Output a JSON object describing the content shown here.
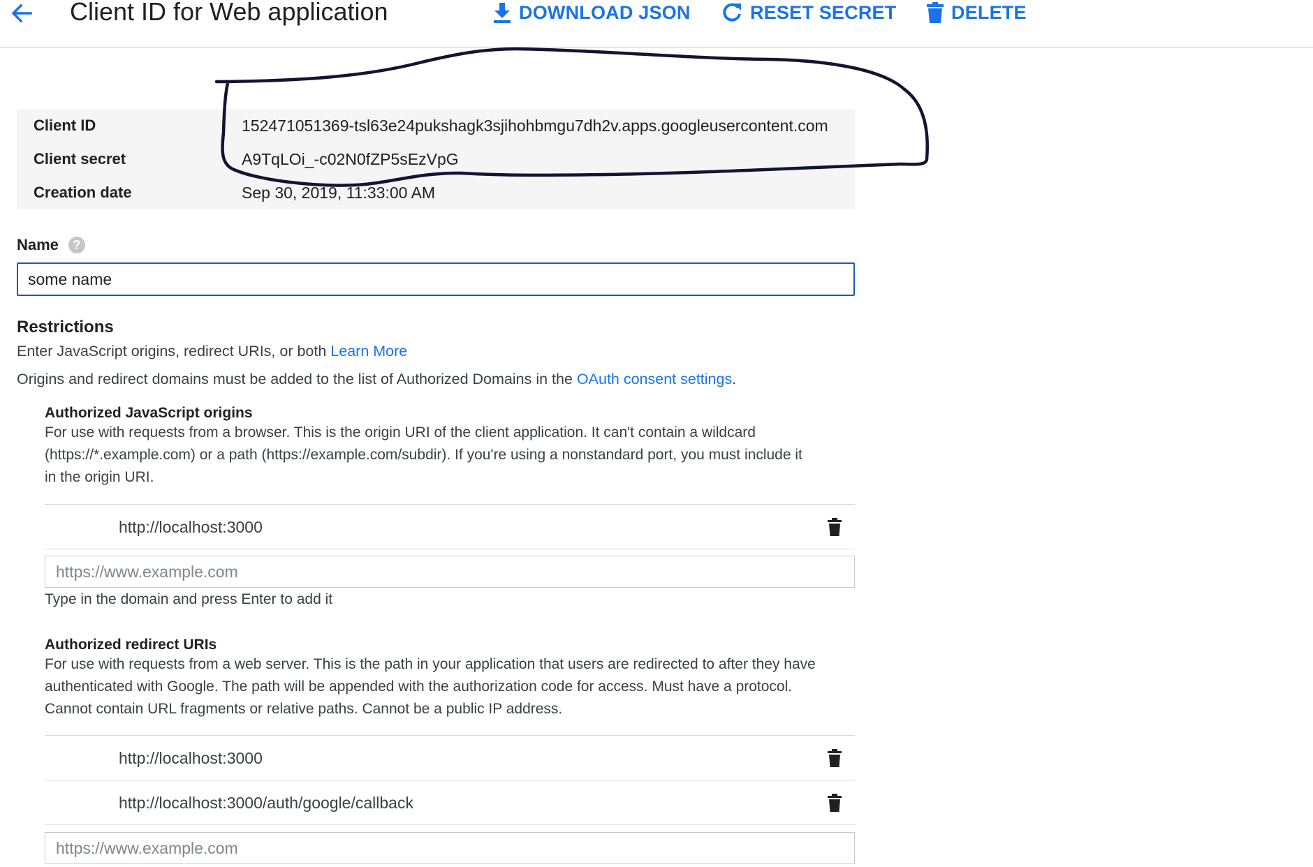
{
  "header": {
    "title": "Client ID for Web application",
    "download_label": "DOWNLOAD JSON",
    "reset_label": "RESET SECRET",
    "delete_label": "DELETE"
  },
  "details": {
    "client_id_label": "Client ID",
    "client_id_value": "152471051369-tsl63e24pukshagk3sjihohbmgu7dh2v.apps.googleusercontent.com",
    "client_secret_label": "Client secret",
    "client_secret_value": "A9TqLOi_-c02N0fZP5sEzVpG",
    "creation_date_label": "Creation date",
    "creation_date_value": "Sep 30, 2019, 11:33:00 AM"
  },
  "name_field": {
    "label": "Name",
    "help_glyph": "?",
    "value": "some name"
  },
  "restrictions": {
    "title": "Restrictions",
    "intro_text": "Enter JavaScript origins, redirect URIs, or both",
    "learn_more": "Learn More",
    "domains_text": "Origins and redirect domains must be added to the list of Authorized Domains in the",
    "consent_link": "OAuth consent settings",
    "period": "."
  },
  "js_origins": {
    "title": "Authorized JavaScript origins",
    "desc_line1": "For use with requests from a browser. This is the origin URI of the client application. It can't contain a wildcard",
    "desc_line2": "(https://*.example.com) or a path (https://example.com/subdir). If you're using a nonstandard port, you must include it",
    "desc_line3": "in the origin URI.",
    "items": [
      "http://localhost:3000"
    ],
    "placeholder": "https://www.example.com",
    "hint": "Type in the domain and press Enter to add it"
  },
  "redirect_uris": {
    "title": "Authorized redirect URIs",
    "desc_line1": "For use with requests from a web server. This is the path in your application that users are redirected to after they have",
    "desc_line2": "authenticated with Google. The path will be appended with the authorization code for access. Must have a protocol.",
    "desc_line3": "Cannot contain URL fragments or relative paths. Cannot be a public IP address.",
    "items": [
      "http://localhost:3000",
      "http://localhost:3000/auth/google/callback"
    ],
    "placeholder": "https://www.example.com"
  },
  "icons": {
    "back": "arrow-left-icon",
    "download": "download-icon",
    "reset": "refresh-icon",
    "delete": "trash-icon"
  },
  "colors": {
    "accent": "#1a73e8",
    "focus_border": "#1a56c5",
    "table_bg": "#f5f5f5",
    "annotation_ink": "#141432"
  }
}
